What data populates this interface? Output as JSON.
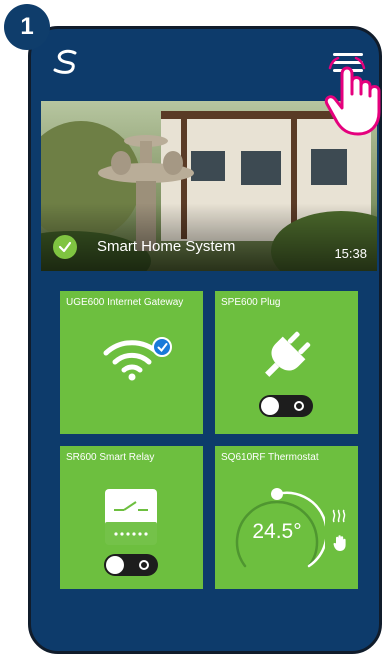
{
  "step": {
    "number": "1"
  },
  "topbar": {
    "logo_icon": "salus-logo-icon",
    "menu_icon": "hamburger-menu-icon"
  },
  "hero": {
    "title": "Smart Home System",
    "time": "15:38",
    "status_icon": "check-circle-icon"
  },
  "devices": [
    {
      "title": "UGE600 Internet Gateway",
      "icon": "wifi-icon",
      "connected": true
    },
    {
      "title": "SPE600 Plug",
      "icon": "plug-icon",
      "state": "off"
    },
    {
      "title": "SR600 Smart Relay",
      "icon": "relay-icon",
      "state": "off"
    },
    {
      "title": "SQ610RF Thermostat",
      "icon": "thermostat-dial-icon",
      "temperature": "24.5°",
      "heating_icon": "heat-waves-icon",
      "manual_icon": "hand-icon"
    }
  ],
  "colors": {
    "background": "#0d3b6b",
    "tile": "#6dbf3f",
    "accent": "#1a7ad9"
  }
}
